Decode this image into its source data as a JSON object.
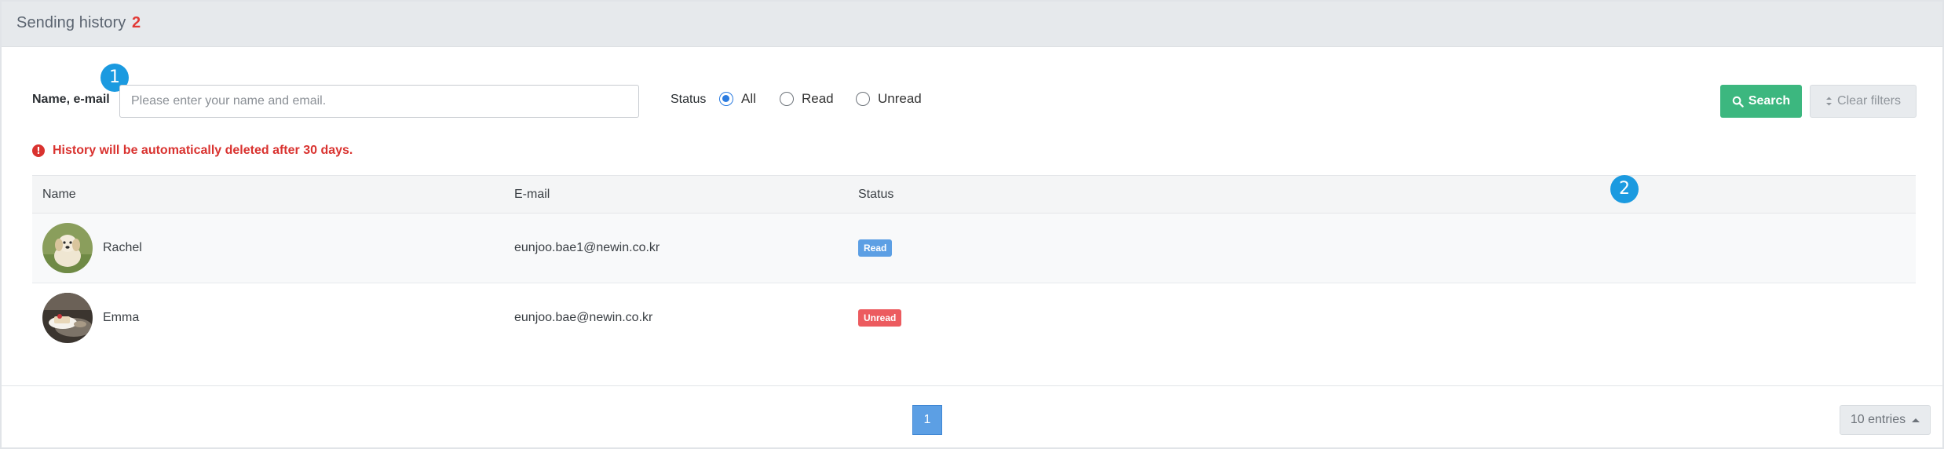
{
  "header": {
    "title": "Sending history",
    "count": "2"
  },
  "filters": {
    "name_email_label": "Name, e-mail",
    "search_placeholder": "Please enter your name and email.",
    "search_value": "",
    "status_label": "Status",
    "status_options": [
      "All",
      "Read",
      "Unread"
    ],
    "status_selected": "All",
    "search_button": "Search",
    "clear_button": "Clear filters"
  },
  "markers": [
    "1",
    "2"
  ],
  "notice": "History will be automatically deleted after 30 days.",
  "table": {
    "columns": [
      "Name",
      "E-mail",
      "Status"
    ],
    "rows": [
      {
        "name": "Rachel",
        "email": "eunjoo.bae1@newin.co.kr",
        "status": "Read"
      },
      {
        "name": "Emma",
        "email": "eunjoo.bae@newin.co.kr",
        "status": "Unread"
      }
    ]
  },
  "pagination": {
    "current_page": "1",
    "entries": "10 entries"
  },
  "colors": {
    "accent": "#1b9ae0",
    "search_green": "#3cb77f",
    "read": "#5c9fe4",
    "unread": "#ec5b5f",
    "alert": "#d9322f"
  },
  "icons": {
    "search": "search-icon",
    "clear": "clear-sort-icon",
    "notice": "info-circle-icon",
    "entries": "caret-up-icon"
  }
}
